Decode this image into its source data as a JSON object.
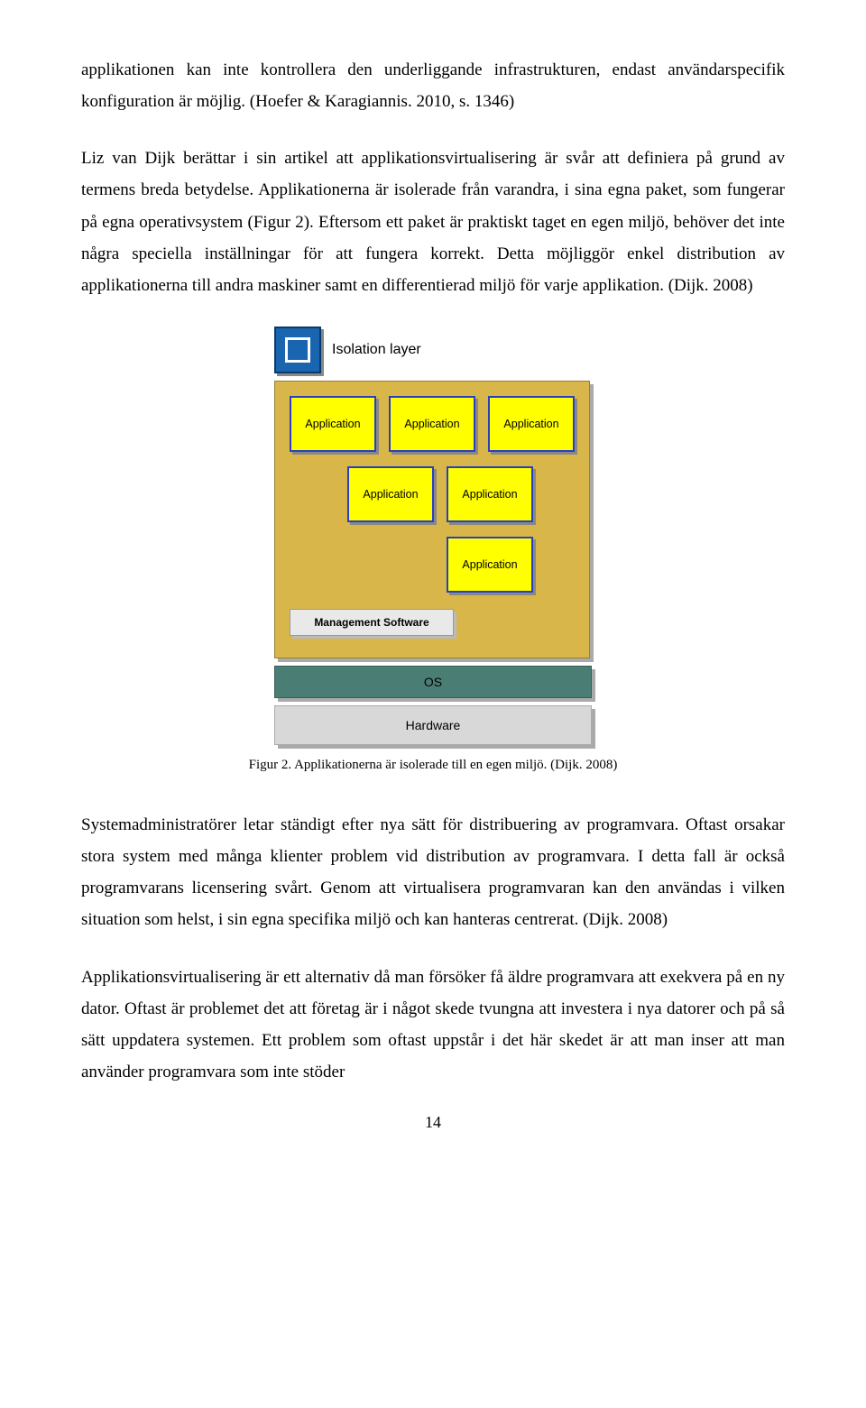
{
  "paragraphs": {
    "p1": "applikationen kan inte kontrollera den underliggande infrastrukturen, endast användarspecifik konfiguration är möjlig. (Hoefer & Karagiannis. 2010, s. 1346)",
    "p2": "Liz van Dijk berättar i sin artikel att applikationsvirtualisering är svår att definiera på grund av termens breda betydelse. Applikationerna är isolerade från varandra, i sina egna paket, som fungerar på egna operativsystem (Figur 2). Eftersom ett paket är praktiskt taget en egen miljö, behöver det inte några speciella inställningar för att fungera korrekt. Detta möjliggör enkel distribution av applikationerna till andra maskiner samt en differentierad miljö för varje applikation. (Dijk. 2008)",
    "p3": "Systemadministratörer letar ständigt efter nya sätt för distribuering av programvara. Oftast orsakar stora system med många klienter problem vid distribution av programvara. I detta fall är också programvarans licensering svårt. Genom att virtualisera programvaran kan den användas i vilken situation som helst, i sin egna specifika miljö och kan hanteras centrerat. (Dijk. 2008)",
    "p4": "Applikationsvirtualisering är ett alternativ då man försöker få äldre programvara att exekvera på en ny dator. Oftast är problemet det att företag är i något skede tvungna att investera i nya datorer och på så sätt uppdatera systemen. Ett problem som oftast uppstår i det här skedet är att man inser att man använder programvara som inte stöder"
  },
  "figure": {
    "isolation_label": "Isolation layer",
    "app_label": "Application",
    "management_label": "Management Software",
    "os_label": "OS",
    "hardware_label": "Hardware",
    "caption": "Figur 2. Applikationerna är isolerade till en egen miljö. (Dijk. 2008)"
  },
  "page_number": "14"
}
